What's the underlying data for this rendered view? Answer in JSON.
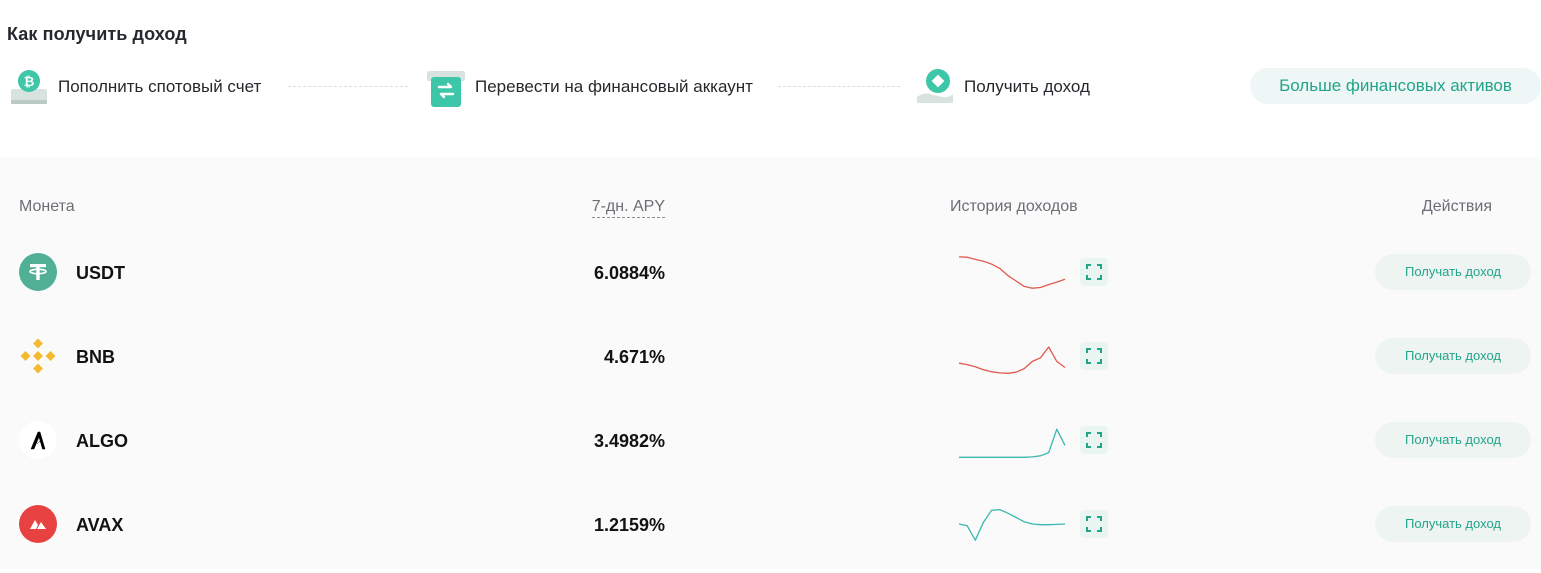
{
  "section": {
    "title": "Как получить доход"
  },
  "steps": [
    {
      "label": "Пополнить спотовый счет",
      "icon": "bitcoin-deposit-icon"
    },
    {
      "label": "Перевести на финансовый аккаунт",
      "icon": "transfer-icon"
    },
    {
      "label": "Получить доход",
      "icon": "earn-diamond-icon"
    }
  ],
  "more_button": {
    "label": "Больше финансовых активов"
  },
  "table": {
    "headers": {
      "coin": "Монета",
      "apy": "7-дн. APY",
      "history": "История доходов",
      "actions": "Действия"
    },
    "rows": [
      {
        "coin": "USDT",
        "apy": "6.0884%",
        "action": "Получать доход",
        "logo_color": "#50af95",
        "trend_color": "#e05a4f",
        "trend": [
          0.92,
          0.91,
          0.85,
          0.8,
          0.72,
          0.6,
          0.4,
          0.25,
          0.1,
          0.05,
          0.07,
          0.15,
          0.22,
          0.3
        ]
      },
      {
        "coin": "BNB",
        "apy": "4.671%",
        "action": "Получать доход",
        "logo_color": "#f3ba2f",
        "trend_color": "#e05a4f",
        "trend": [
          0.3,
          0.26,
          0.2,
          0.12,
          0.06,
          0.03,
          0.02,
          0.05,
          0.15,
          0.35,
          0.45,
          0.75,
          0.35,
          0.18
        ]
      },
      {
        "coin": "ALGO",
        "apy": "3.4982%",
        "action": "Получать доход",
        "logo_color": "#ffffff",
        "trend_color": "#3cb7b0",
        "trend": [
          0.02,
          0.02,
          0.02,
          0.02,
          0.02,
          0.02,
          0.02,
          0.02,
          0.02,
          0.03,
          0.06,
          0.15,
          0.8,
          0.35
        ]
      },
      {
        "coin": "AVAX",
        "apy": "1.2159%",
        "action": "Получать доход",
        "logo_color": "#e84142",
        "trend_color": "#3cb7b0",
        "trend": [
          0.5,
          0.45,
          0.05,
          0.55,
          0.88,
          0.9,
          0.8,
          0.68,
          0.56,
          0.5,
          0.48,
          0.48,
          0.49,
          0.5
        ]
      }
    ]
  },
  "colors": {
    "accent": "#21a48a",
    "button_bg": "#eef7f5",
    "table_bg": "#fafafa"
  }
}
